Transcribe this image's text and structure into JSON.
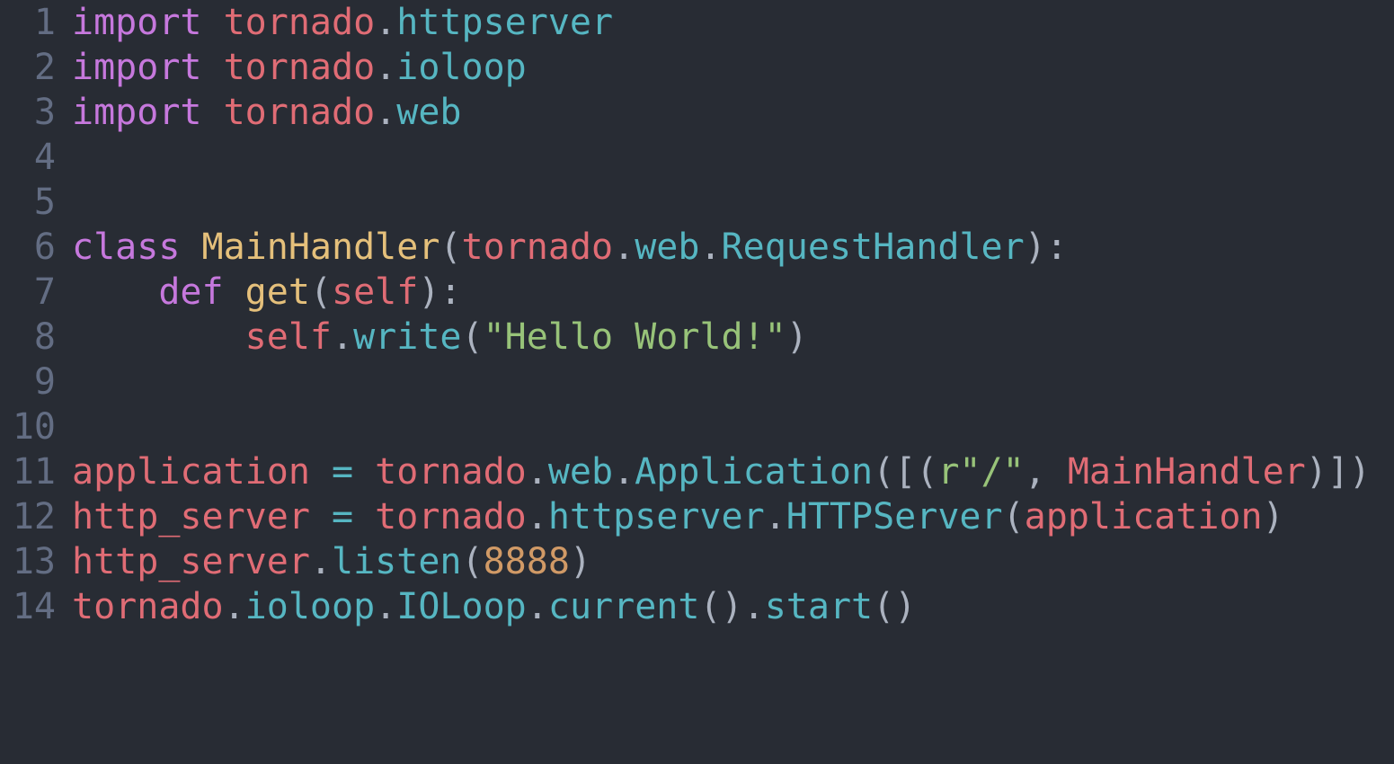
{
  "editor": {
    "line_numbers": [
      "1",
      "2",
      "3",
      "4",
      "5",
      "6",
      "7",
      "8",
      "9",
      "10",
      "11",
      "12",
      "13",
      "14"
    ]
  },
  "code": {
    "l1": {
      "kw": "import",
      "mod": "tornado",
      "dot": ".",
      "attr": "httpserver"
    },
    "l2": {
      "kw": "import",
      "mod": "tornado",
      "dot": ".",
      "attr": "ioloop"
    },
    "l3": {
      "kw": "import",
      "mod": "tornado",
      "dot": ".",
      "attr": "web"
    },
    "l6": {
      "kw": "class",
      "name": "MainHandler",
      "open": "(",
      "mod": "tornado",
      "dot1": ".",
      "attr1": "web",
      "dot2": ".",
      "attr2": "RequestHandler",
      "close": "):"
    },
    "l7": {
      "indent": "    ",
      "kw": "def",
      "name": "get",
      "open": "(",
      "self": "self",
      "close": "):"
    },
    "l8": {
      "indent": "        ",
      "self": "self",
      "dot": ".",
      "method": "write",
      "open": "(",
      "str": "\"Hello World!\"",
      "close": ")"
    },
    "l11": {
      "var": "application",
      "eq": " = ",
      "mod": "tornado",
      "dot1": ".",
      "attr1": "web",
      "dot2": ".",
      "attr2": "Application",
      "open": "([(",
      "str": "r\"/\"",
      "comma": ", ",
      "arg": "MainHandler",
      "close": ")])"
    },
    "l12": {
      "var": "http_server",
      "eq": " = ",
      "mod": "tornado",
      "dot1": ".",
      "attr1": "httpserver",
      "dot2": ".",
      "attr2": "HTTPServer",
      "open": "(",
      "arg": "application",
      "close": ")"
    },
    "l13": {
      "var": "http_server",
      "dot": ".",
      "method": "listen",
      "open": "(",
      "num": "8888",
      "close": ")"
    },
    "l14": {
      "mod": "tornado",
      "dot1": ".",
      "attr1": "ioloop",
      "dot2": ".",
      "attr2": "IOLoop",
      "dot3": ".",
      "method1": "current",
      "paren1": "()",
      "dot4": ".",
      "method2": "start",
      "paren2": "()"
    }
  },
  "colors": {
    "background": "#282c34",
    "line_number": "#636d83",
    "keyword": "#c678dd",
    "module": "#e06c75",
    "attribute": "#56b6c2",
    "class_name": "#e5c07b",
    "string": "#98c379",
    "number": "#d19a66",
    "punctuation": "#abb2bf"
  }
}
